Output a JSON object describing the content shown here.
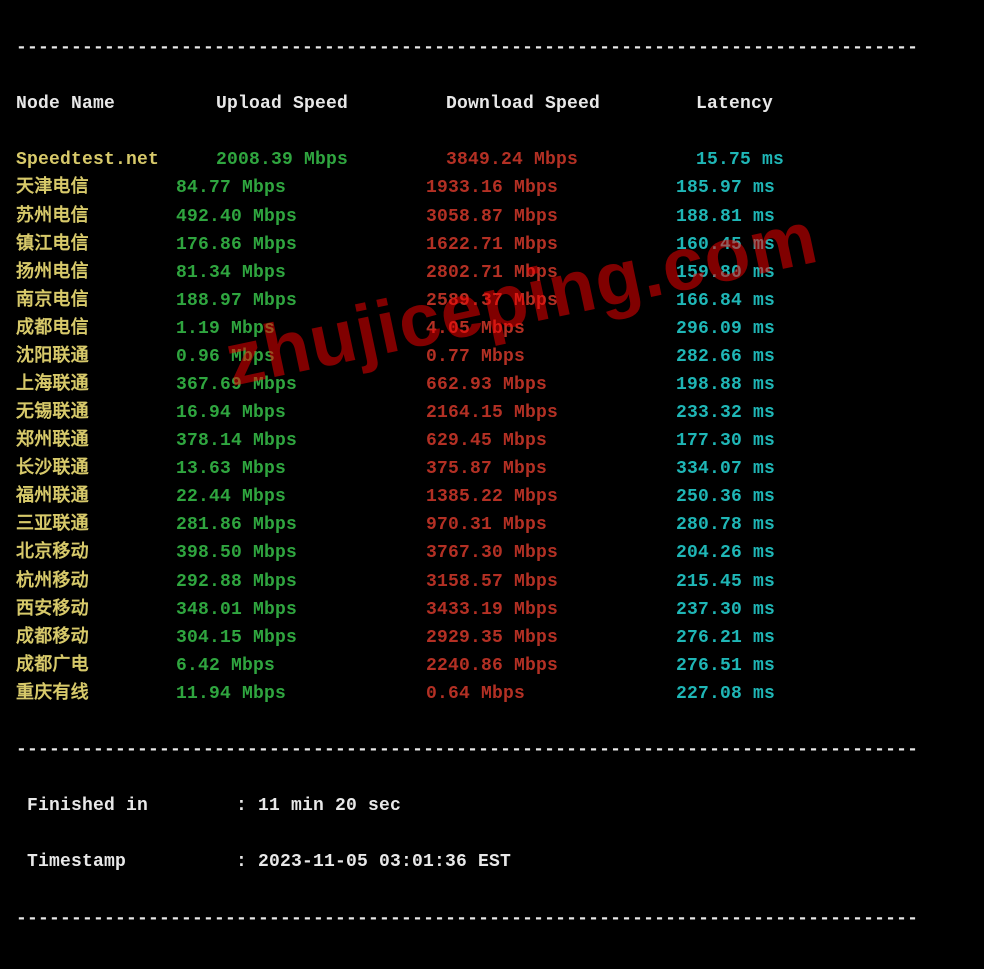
{
  "divider": "----------------------------------------------------------------------------------",
  "headers": {
    "node": "Node Name",
    "upload": "Upload Speed",
    "download": "Download Speed",
    "latency": "Latency"
  },
  "rows": [
    {
      "node": "Speedtest.net",
      "up": "2008.39 Mbps",
      "down": "3849.24 Mbps",
      "lat": "15.75 ms",
      "special": true
    },
    {
      "node": "天津电信",
      "up": "84.77 Mbps",
      "down": "1933.16 Mbps",
      "lat": "185.97 ms"
    },
    {
      "node": "苏州电信",
      "up": "492.40 Mbps",
      "down": "3058.87 Mbps",
      "lat": "188.81 ms"
    },
    {
      "node": "镇江电信",
      "up": "176.86 Mbps",
      "down": "1622.71 Mbps",
      "lat": "160.45 ms"
    },
    {
      "node": "扬州电信",
      "up": "81.34 Mbps",
      "down": "2802.71 Mbps",
      "lat": "159.80 ms"
    },
    {
      "node": "南京电信",
      "up": "188.97 Mbps",
      "down": "2589.37 Mbps",
      "lat": "166.84 ms"
    },
    {
      "node": "成都电信",
      "up": "1.19 Mbps",
      "down": "4.05 Mbps",
      "lat": "296.09 ms"
    },
    {
      "node": "沈阳联通",
      "up": "0.96 Mbps",
      "down": "0.77 Mbps",
      "lat": "282.66 ms"
    },
    {
      "node": "上海联通",
      "up": "367.69 Mbps",
      "down": "662.93 Mbps",
      "lat": "198.88 ms"
    },
    {
      "node": "无锡联通",
      "up": "16.94 Mbps",
      "down": "2164.15 Mbps",
      "lat": "233.32 ms"
    },
    {
      "node": "郑州联通",
      "up": "378.14 Mbps",
      "down": "629.45 Mbps",
      "lat": "177.30 ms"
    },
    {
      "node": "长沙联通",
      "up": "13.63 Mbps",
      "down": "375.87 Mbps",
      "lat": "334.07 ms"
    },
    {
      "node": "福州联通",
      "up": "22.44 Mbps",
      "down": "1385.22 Mbps",
      "lat": "250.36 ms"
    },
    {
      "node": "三亚联通",
      "up": "281.86 Mbps",
      "down": "970.31 Mbps",
      "lat": "280.78 ms"
    },
    {
      "node": "北京移动",
      "up": "398.50 Mbps",
      "down": "3767.30 Mbps",
      "lat": "204.26 ms"
    },
    {
      "node": "杭州移动",
      "up": "292.88 Mbps",
      "down": "3158.57 Mbps",
      "lat": "215.45 ms"
    },
    {
      "node": "西安移动",
      "up": "348.01 Mbps",
      "down": "3433.19 Mbps",
      "lat": "237.30 ms"
    },
    {
      "node": "成都移动",
      "up": "304.15 Mbps",
      "down": "2929.35 Mbps",
      "lat": "276.21 ms"
    },
    {
      "node": "成都广电",
      "up": "6.42 Mbps",
      "down": "2240.86 Mbps",
      "lat": "276.51 ms"
    },
    {
      "node": "重庆有线",
      "up": "11.94 Mbps",
      "down": "0.64 Mbps",
      "lat": "227.08 ms"
    }
  ],
  "footer": {
    "finished_label": " Finished in",
    "finished_sep": ": ",
    "finished_value": "11 min 20 sec",
    "timestamp_label": " Timestamp",
    "timestamp_sep": ": ",
    "timestamp_value": "2023-11-05 03:01:36 EST"
  },
  "watermark": "zhujiceping.com"
}
